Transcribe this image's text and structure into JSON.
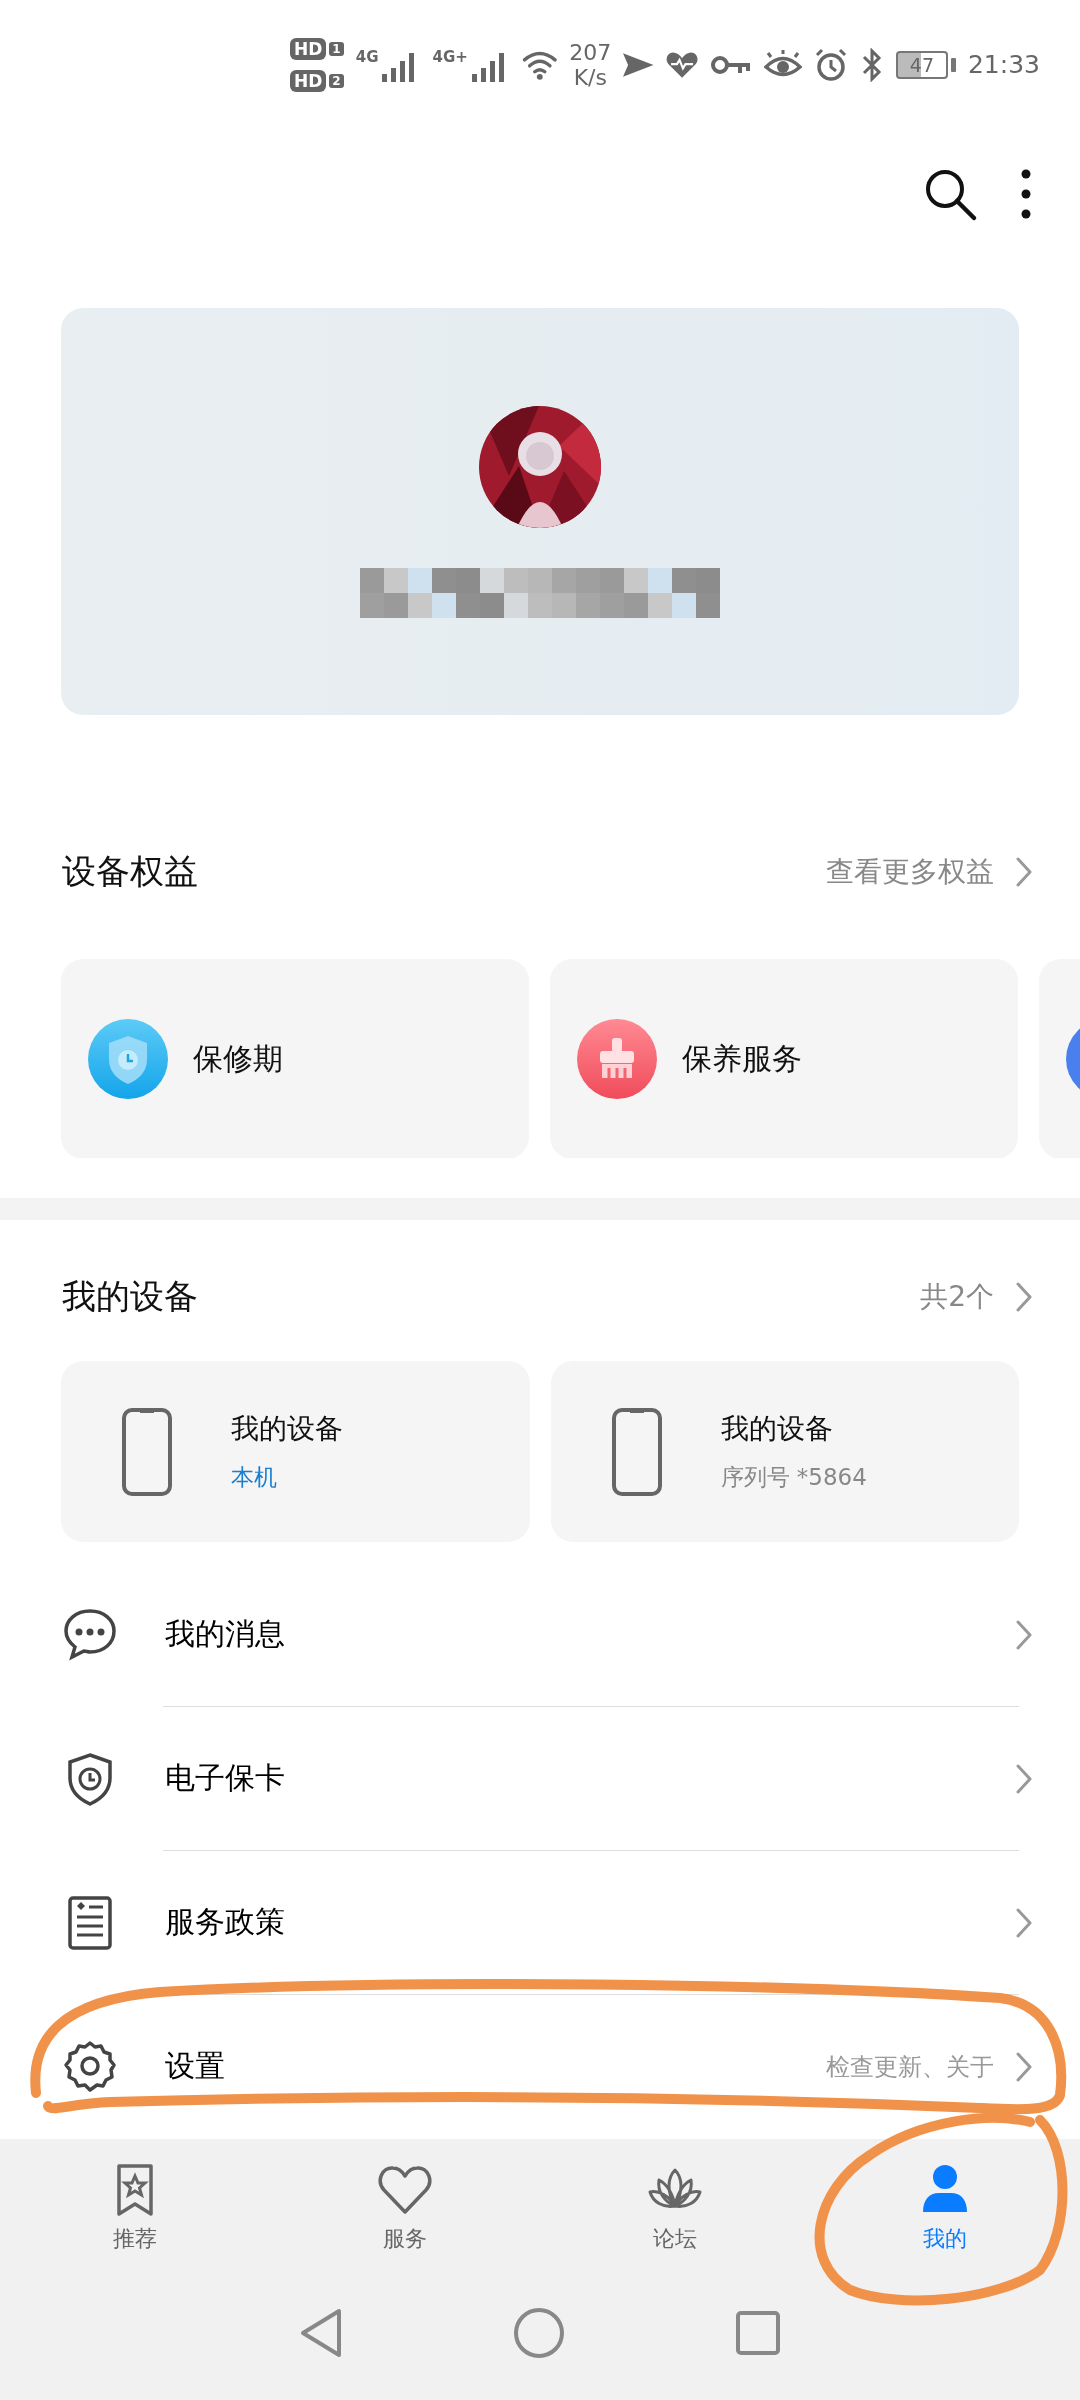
{
  "status_bar": {
    "sims": [
      {
        "text": "HD",
        "slot": "1"
      },
      {
        "text": "HD",
        "slot": "2"
      }
    ],
    "networks": [
      "4G",
      "4G+"
    ],
    "speed_value": "207",
    "speed_unit": "K/s",
    "battery": "47",
    "time": "21:33"
  },
  "benefits": {
    "title": "设备权益",
    "link": "查看更多权益",
    "items": [
      {
        "label": "保修期",
        "kind": "warranty"
      },
      {
        "label": "保养服务",
        "kind": "maintenance"
      },
      {
        "kind": "partial"
      }
    ]
  },
  "devices": {
    "title": "我的设备",
    "count": "共2个",
    "items": [
      {
        "name": "我的设备",
        "detail": "本机",
        "current": true
      },
      {
        "name": "我的设备",
        "detail": "序列号 *5864",
        "current": false
      }
    ]
  },
  "menu": [
    {
      "label": "我的消息",
      "kind": "message"
    },
    {
      "label": "电子保卡",
      "kind": "shield"
    },
    {
      "label": "服务政策",
      "kind": "document"
    },
    {
      "label": "设置",
      "kind": "gear",
      "hint": "检查更新、关于"
    }
  ],
  "tabs": [
    {
      "label": "推荐",
      "kind": "bookmark",
      "selected": false
    },
    {
      "label": "服务",
      "kind": "heart",
      "selected": false
    },
    {
      "label": "论坛",
      "kind": "lotus",
      "selected": false
    },
    {
      "label": "我的",
      "kind": "person",
      "selected": true
    }
  ]
}
